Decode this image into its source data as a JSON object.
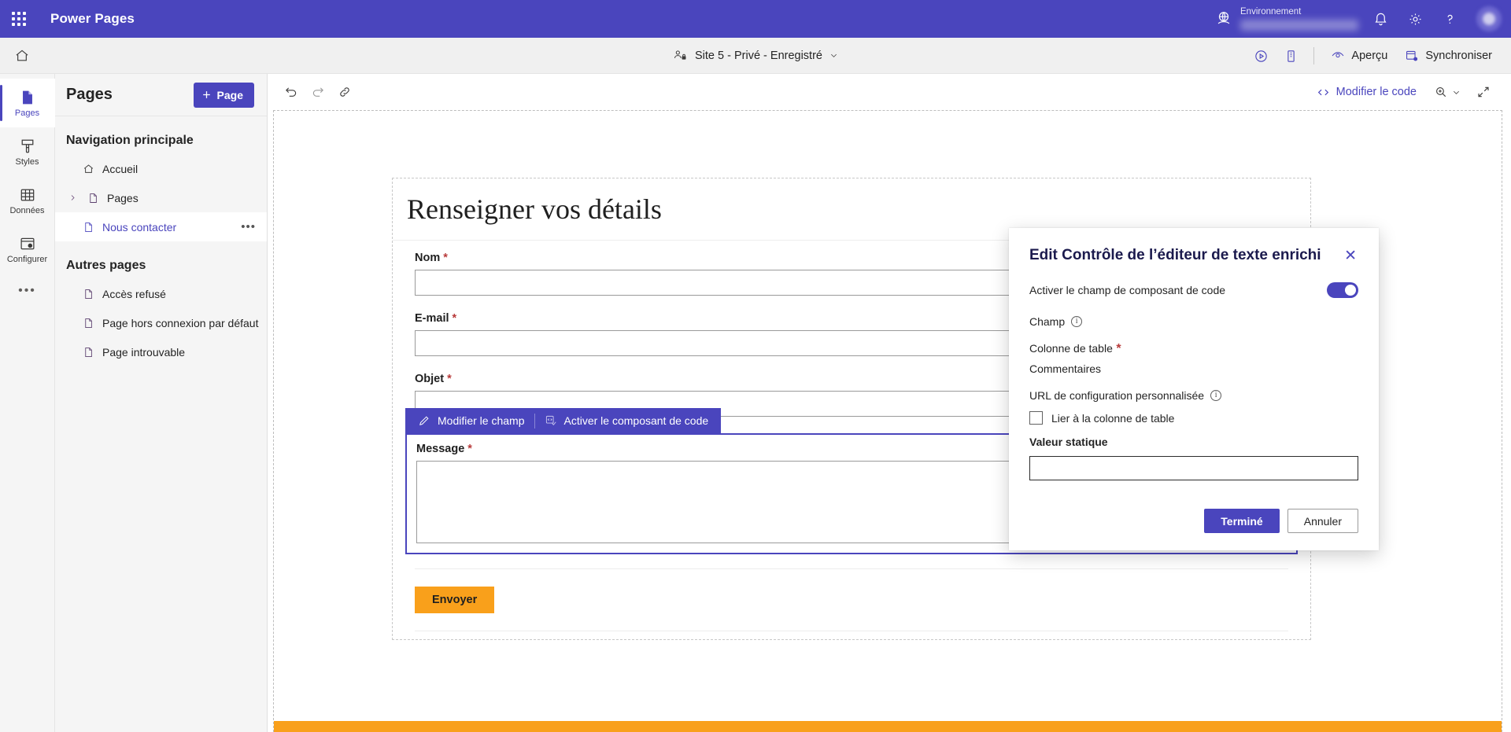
{
  "brandbar": {
    "waffle_label": "app-launcher",
    "app_title": "Power Pages",
    "environment_label": "Environnement",
    "environment_value": "",
    "notifications_label": "Notifications",
    "settings_label": "Paramètres",
    "help_label": "Aide",
    "account_label": "Compte",
    "accent_color": "#4a45bd"
  },
  "apptoolbar": {
    "home_label": "Accueil",
    "site_name": "Site 5 - Privé - Enregistré",
    "preview_label": "Aperçu",
    "sync_label": "Synchroniser",
    "play_label": "Lecture",
    "device_label": "Affichage mobile"
  },
  "rail": {
    "items": [
      {
        "icon": "pages-icon",
        "label": "Pages",
        "active": true
      },
      {
        "icon": "brush-icon",
        "label": "Styles",
        "active": false
      },
      {
        "icon": "table-icon",
        "label": "Données",
        "active": false
      },
      {
        "icon": "setup-icon",
        "label": "Configurer",
        "active": false
      }
    ],
    "more_label": "•••"
  },
  "panel": {
    "title": "Pages",
    "add_button": "Page",
    "groups": [
      {
        "title": "Navigation principale",
        "items": [
          {
            "label": "Accueil",
            "icon": "home-icon",
            "chevron": false,
            "selected": false,
            "ellipsis": false
          },
          {
            "label": "Pages",
            "icon": "page-icon",
            "chevron": true,
            "selected": false,
            "ellipsis": false
          },
          {
            "label": "Nous contacter",
            "icon": "page-icon",
            "chevron": false,
            "selected": true,
            "ellipsis": true
          }
        ]
      },
      {
        "title": "Autres pages",
        "items": [
          {
            "label": "Accès refusé",
            "icon": "page-icon",
            "chevron": false,
            "selected": false,
            "ellipsis": false
          },
          {
            "label": "Page hors connexion par défaut",
            "icon": "page-icon",
            "chevron": false,
            "selected": false,
            "ellipsis": false
          },
          {
            "label": "Page introuvable",
            "icon": "page-icon",
            "chevron": false,
            "selected": false,
            "ellipsis": false
          }
        ]
      }
    ],
    "ellipsis_label": "•••"
  },
  "canvas_toolbar": {
    "undo_label": "Annuler",
    "redo_label": "Rétablir",
    "link_label": "Lien",
    "edit_code_label": "Modifier le code",
    "zoom_label": "Zoom"
  },
  "form": {
    "heading": "Renseigner vos détails",
    "fields": [
      {
        "label": "Nom",
        "required": "*",
        "type": "text"
      },
      {
        "label": "E-mail",
        "required": "*",
        "type": "text"
      },
      {
        "label": "Objet",
        "required": "*",
        "type": "text"
      },
      {
        "label": "Message",
        "required": "*",
        "type": "textarea"
      }
    ],
    "submit_label": "Envoyer",
    "float_toolbar": {
      "edit_field_label": "Modifier le champ",
      "enable_code_label": "Activer le composant de code"
    },
    "accent_color": "#4a45bd",
    "submit_color": "#f9a01b"
  },
  "modal": {
    "title": "Edit Contrôle de l’éditeur de texte enrichi",
    "close_label": "✕",
    "toggle_label": "Activer le champ de composant de code",
    "toggle_on": true,
    "field_section_label": "Champ",
    "table_column_label": "Colonne de table",
    "table_column_required": "*",
    "table_column_value": "Commentaires",
    "custom_url_label": "URL de configuration personnalisée",
    "link_checkbox_label": "Lier à la colonne de table",
    "link_checkbox_checked": false,
    "static_value_label": "Valeur statique",
    "static_value": "",
    "done_label": "Terminé",
    "cancel_label": "Annuler"
  }
}
